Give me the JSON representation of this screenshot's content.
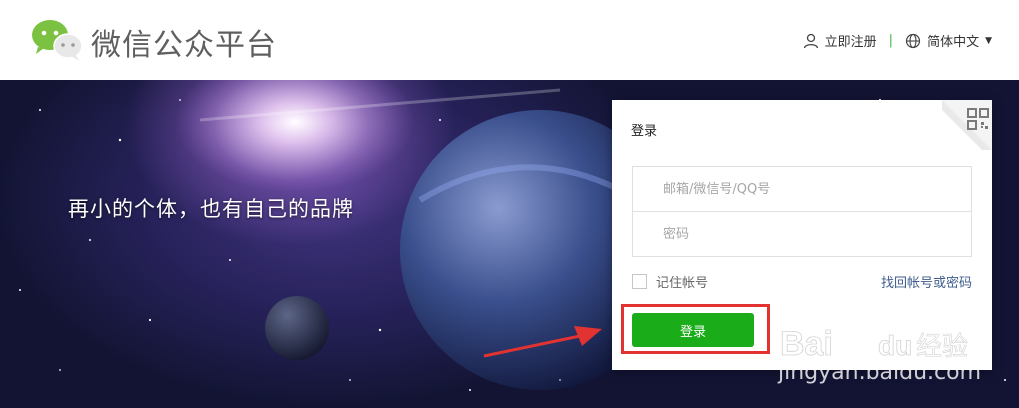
{
  "header": {
    "brand": "微信公众平台",
    "register": "立即注册",
    "separator": "|",
    "language": "简体中文"
  },
  "banner": {
    "tagline": "再小的个体，也有自己的品牌"
  },
  "login": {
    "title": "登录",
    "username_placeholder": "邮箱/微信号/QQ号",
    "password_placeholder": "密码",
    "remember": "记住帐号",
    "forgot": "找回帐号或密码",
    "submit": "登录"
  },
  "watermark": {
    "text": "jingyan.baidu.com",
    "logo_text": "Bai du 经验"
  },
  "colors": {
    "brand_green": "#1aad19",
    "highlight_red": "#e23232",
    "link_blue": "#3f5d8d"
  }
}
